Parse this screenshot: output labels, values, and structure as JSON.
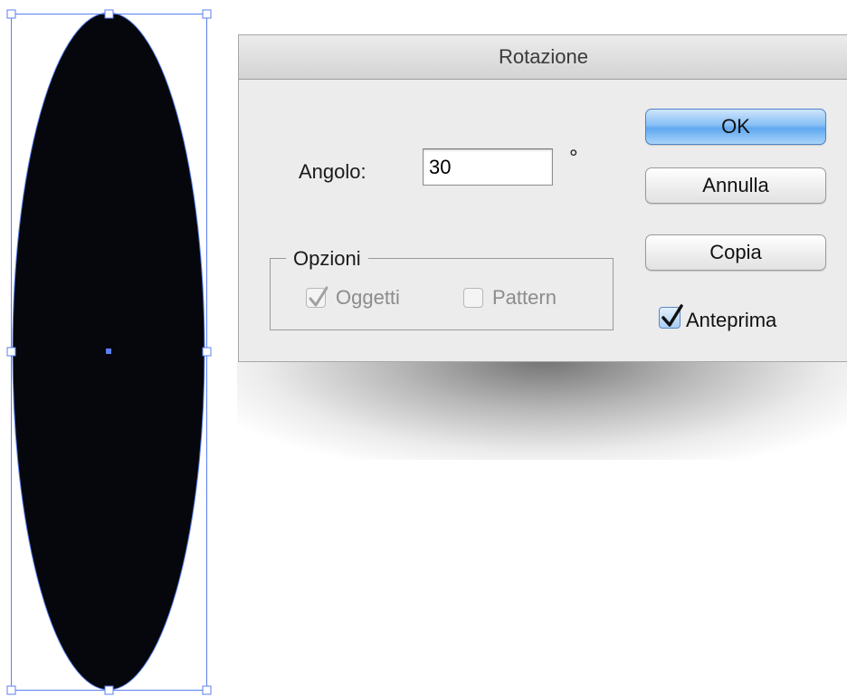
{
  "dialog": {
    "title": "Rotazione",
    "angle_label": "Angolo:",
    "angle_value": "30",
    "degree_symbol": "°",
    "options_group_title": "Opzioni",
    "options": [
      {
        "label": "Oggetti",
        "checked": true,
        "enabled": false
      },
      {
        "label": "Pattern",
        "checked": false,
        "enabled": false
      }
    ],
    "buttons": {
      "ok": "OK",
      "cancel": "Annulla",
      "copy": "Copia"
    },
    "preview": {
      "label": "Anteprima",
      "checked": true
    }
  },
  "canvas": {
    "selected_object": "ellipse",
    "fill_color": "#05070c",
    "selection_color": "#5b7ff0"
  },
  "colors": {
    "dialog_bg": "#ececec",
    "default_button": "#6aaaf0"
  }
}
